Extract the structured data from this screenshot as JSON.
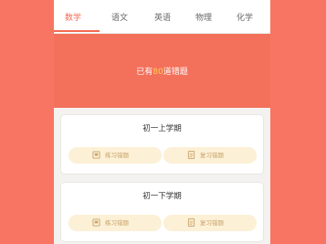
{
  "tabs": [
    "数学",
    "语文",
    "英语",
    "物理",
    "化学"
  ],
  "active_tab": "数学",
  "banner": {
    "prefix": "已有",
    "count": "80",
    "suffix": "道错题"
  },
  "cards": [
    {
      "title": "初一上学期",
      "practice_label": "练习错题",
      "review_label": "复习错题"
    },
    {
      "title": "初一下学期",
      "practice_label": "练习错题",
      "review_label": "复习错题"
    }
  ],
  "colors": {
    "background": "#f97563",
    "accent": "#f36a52",
    "count_highlight": "#ffcf4a",
    "pill": "#fcf0d6"
  }
}
